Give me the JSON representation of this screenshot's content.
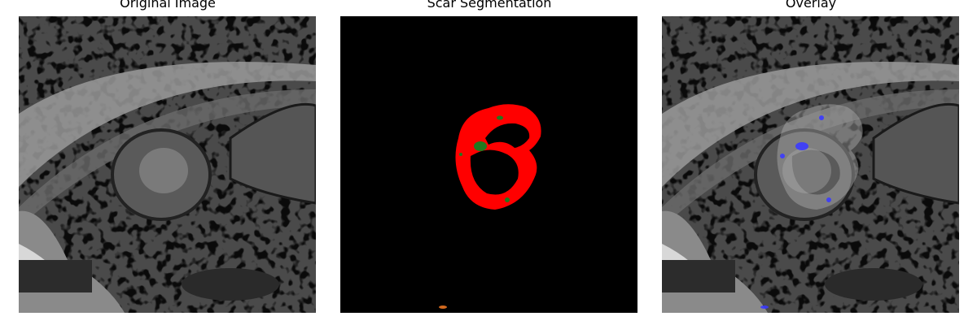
{
  "panels": [
    {
      "title": "Original Image"
    },
    {
      "title": "Scar Segmentation"
    },
    {
      "title": "Overlay"
    }
  ],
  "colors": {
    "background": "#ffffff",
    "segmentation_background": "#000000",
    "scar_red": "#ff0000",
    "segment_green": "#1f7a1f",
    "overlay_blue": "#3a3aff",
    "artifact_orange": "#d2691e"
  }
}
